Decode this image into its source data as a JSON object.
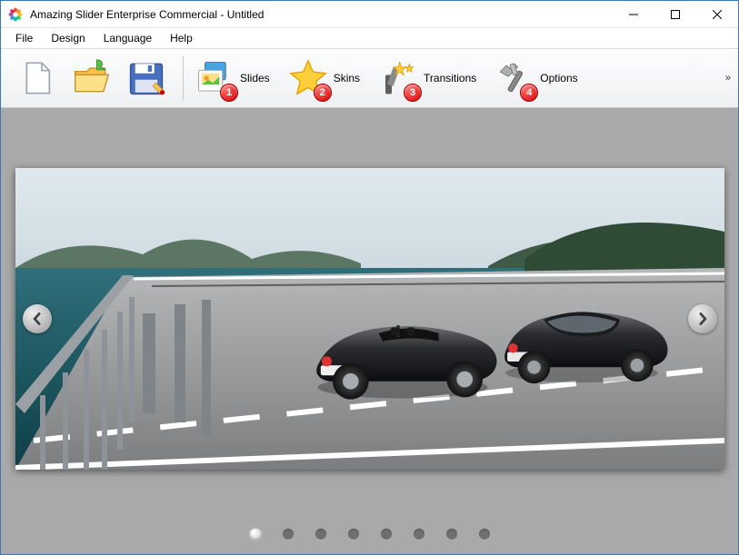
{
  "window": {
    "title": "Amazing Slider Enterprise Commercial - Untitled"
  },
  "menu": {
    "file": "File",
    "design": "Design",
    "language": "Language",
    "help": "Help"
  },
  "toolbar": {
    "slides": "Slides",
    "skins": "Skins",
    "transitions": "Transitions",
    "options": "Options",
    "badges": {
      "slides": "1",
      "skins": "2",
      "transitions": "3",
      "options": "4"
    },
    "more": "»"
  },
  "slider": {
    "total_dots": 8,
    "active_dot_index": 0
  }
}
